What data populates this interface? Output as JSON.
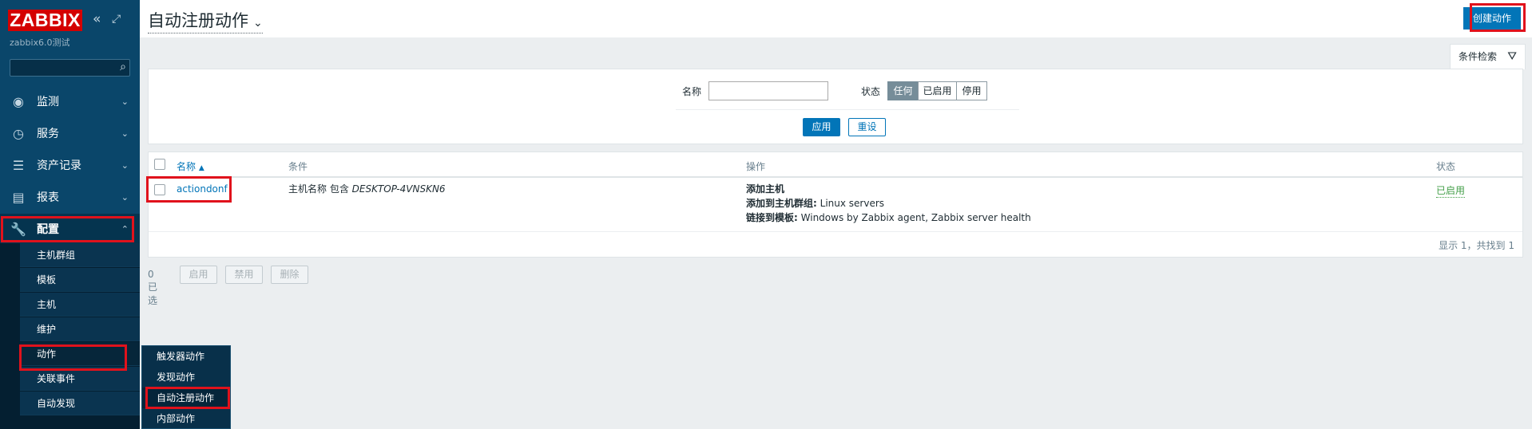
{
  "sidebar": {
    "logo": "ZABBIX",
    "server_name": "zabbix6.0测试",
    "menu": [
      {
        "label": "监测",
        "icon": "eye-icon"
      },
      {
        "label": "服务",
        "icon": "clock-icon"
      },
      {
        "label": "资产记录",
        "icon": "list-icon"
      },
      {
        "label": "报表",
        "icon": "chart-icon"
      },
      {
        "label": "配置",
        "icon": "wrench-icon"
      }
    ],
    "config_submenu": [
      "主机群组",
      "模板",
      "主机",
      "维护",
      "动作",
      "关联事件",
      "自动发现"
    ],
    "actions_flyout": [
      "触发器动作",
      "发现动作",
      "自动注册动作",
      "内部动作"
    ]
  },
  "header": {
    "title": "自动注册动作",
    "create_button": "创建动作"
  },
  "filter": {
    "tab_label": "条件检索",
    "name_label": "名称",
    "name_value": "",
    "status_label": "状态",
    "status_options": [
      "任何",
      "已启用",
      "停用"
    ],
    "status_selected": "任何",
    "apply": "应用",
    "reset": "重设"
  },
  "table": {
    "columns": [
      "名称",
      "条件",
      "操作",
      "状态"
    ],
    "rows": [
      {
        "name": "actiondonf",
        "condition_prefix": "主机名称 包含 ",
        "condition_value": "DESKTOP-4VNSKN6",
        "op1_label": "添加主机",
        "op2_label": "添加到主机群组:",
        "op2_value": " Linux servers",
        "op3_label": "链接到模板:",
        "op3_value": " Windows by Zabbix agent, Zabbix server health",
        "status": "已启用"
      }
    ],
    "footer": "显示 1，共找到 1"
  },
  "bulk": {
    "selected": "0 已选",
    "buttons": [
      "启用",
      "禁用",
      "删除"
    ]
  }
}
